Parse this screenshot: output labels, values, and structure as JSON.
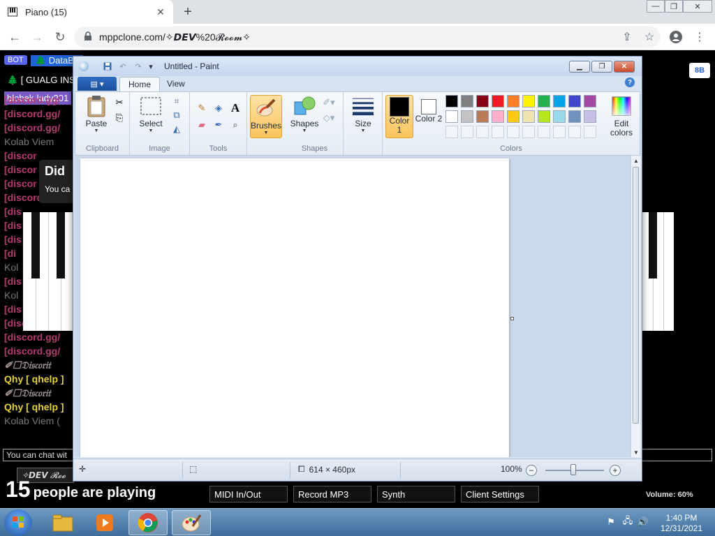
{
  "browser": {
    "tab_title": "Piano (15)",
    "tab_close": "✕",
    "new_tab": "+",
    "url": "mppclone.com/✧𝘿𝙀𝙑%20𝓡𝓸𝓸𝓶✧",
    "window_controls": {
      "minimize": "—",
      "restore": "❐",
      "close": "✕"
    }
  },
  "mpp": {
    "bot_badge": "BOT",
    "bot_name": "🌲 DataBo",
    "gualg": "🌲 [ GUALG INS",
    "blobek": "blobek-lady201",
    "did_heading": "Did",
    "did_body": "You ca",
    "chat_lines": [
      {
        "text": "[discord.gg/",
        "cls": "c-discord"
      },
      {
        "text": "[discord.gg/",
        "cls": "c-discord"
      },
      {
        "text": "[discord.gg/",
        "cls": "c-discord"
      },
      {
        "text": "Kolab Viem",
        "cls": "c-kolab"
      },
      {
        "text": "[discor",
        "cls": "c-discord"
      },
      {
        "text": "[discor",
        "cls": "c-discord"
      },
      {
        "text": "[discor",
        "cls": "c-discord"
      },
      {
        "text": "[discord.g",
        "cls": "c-discord"
      },
      {
        "text": "[dis",
        "cls": "c-discord"
      },
      {
        "text": "[dis",
        "cls": "c-discord"
      },
      {
        "text": "[dis",
        "cls": "c-discord"
      },
      {
        "text": "[di",
        "cls": "c-discord"
      },
      {
        "text": "Kol",
        "cls": "c-kolab"
      },
      {
        "text": "[dis",
        "cls": "c-discord"
      },
      {
        "text": "Kol",
        "cls": "c-kolab"
      },
      {
        "text": "[dis",
        "cls": "c-discord"
      },
      {
        "text": "[discord.gg/",
        "cls": "c-discord"
      },
      {
        "text": "[discord.gg/",
        "cls": "c-discord"
      },
      {
        "text": "[discord.gg/",
        "cls": "c-discord"
      },
      {
        "text": "✐☐𝔇𝔦𝔰𝔠𝔬𝔯𝔦𝔱",
        "cls": "c-gray"
      },
      {
        "text": "Qhy [ qhelp ]",
        "cls": "c-qhy"
      },
      {
        "text": "✐☐𝔇𝔦𝔰𝔠𝔬𝔯𝔦𝔱",
        "cls": "c-gray"
      },
      {
        "text": "Qhy [ qhelp ]",
        "cls": "c-qhy"
      },
      {
        "text": "Kolab Viem (",
        "cls": "c-kolab"
      }
    ],
    "chat_placeholder": "You can chat wit",
    "room_button": "✧𝘿𝙀𝙑 𝓡𝓸𝓸",
    "player_count": "15",
    "players_text": "people are playing",
    "buttons": [
      "MIDI In/Out",
      "Record MP3",
      "Synth",
      "Client Settings"
    ],
    "volume": "Volume: 60%",
    "bb_button": "8B"
  },
  "paint": {
    "title": "Untitled - Paint",
    "file_menu": "▤ ▾",
    "tabs": [
      "Home",
      "View"
    ],
    "help": "?",
    "groups": {
      "clipboard": {
        "label": "Clipboard",
        "paste": "Paste"
      },
      "image": {
        "label": "Image",
        "select": "Select"
      },
      "tools": {
        "label": "Tools"
      },
      "brushes": {
        "label": "Brushes"
      },
      "shapes": {
        "label": "Shapes",
        "shapes": "Shapes"
      },
      "size": {
        "label": "Size"
      },
      "colors": {
        "label": "Colors",
        "color1": "Color 1",
        "color2": "Color 2",
        "edit": "Edit colors"
      }
    },
    "color1_value": "#000000",
    "color2_value": "#ffffff",
    "palette_row1": [
      "#000000",
      "#7f7f7f",
      "#880015",
      "#ed1c24",
      "#ff7f27",
      "#fff200",
      "#22b14c",
      "#00a2e8",
      "#3f48cc",
      "#a349a4"
    ],
    "palette_row2": [
      "#ffffff",
      "#c3c3c3",
      "#b97a57",
      "#ffaec9",
      "#ffc90e",
      "#efe4b0",
      "#b5e61d",
      "#99d9ea",
      "#7092be",
      "#c8bfe7"
    ],
    "status": {
      "dimensions": "614 × 460px",
      "zoom": "100%"
    }
  },
  "taskbar": {
    "time": "1:40 PM",
    "date": "12/31/2021"
  }
}
